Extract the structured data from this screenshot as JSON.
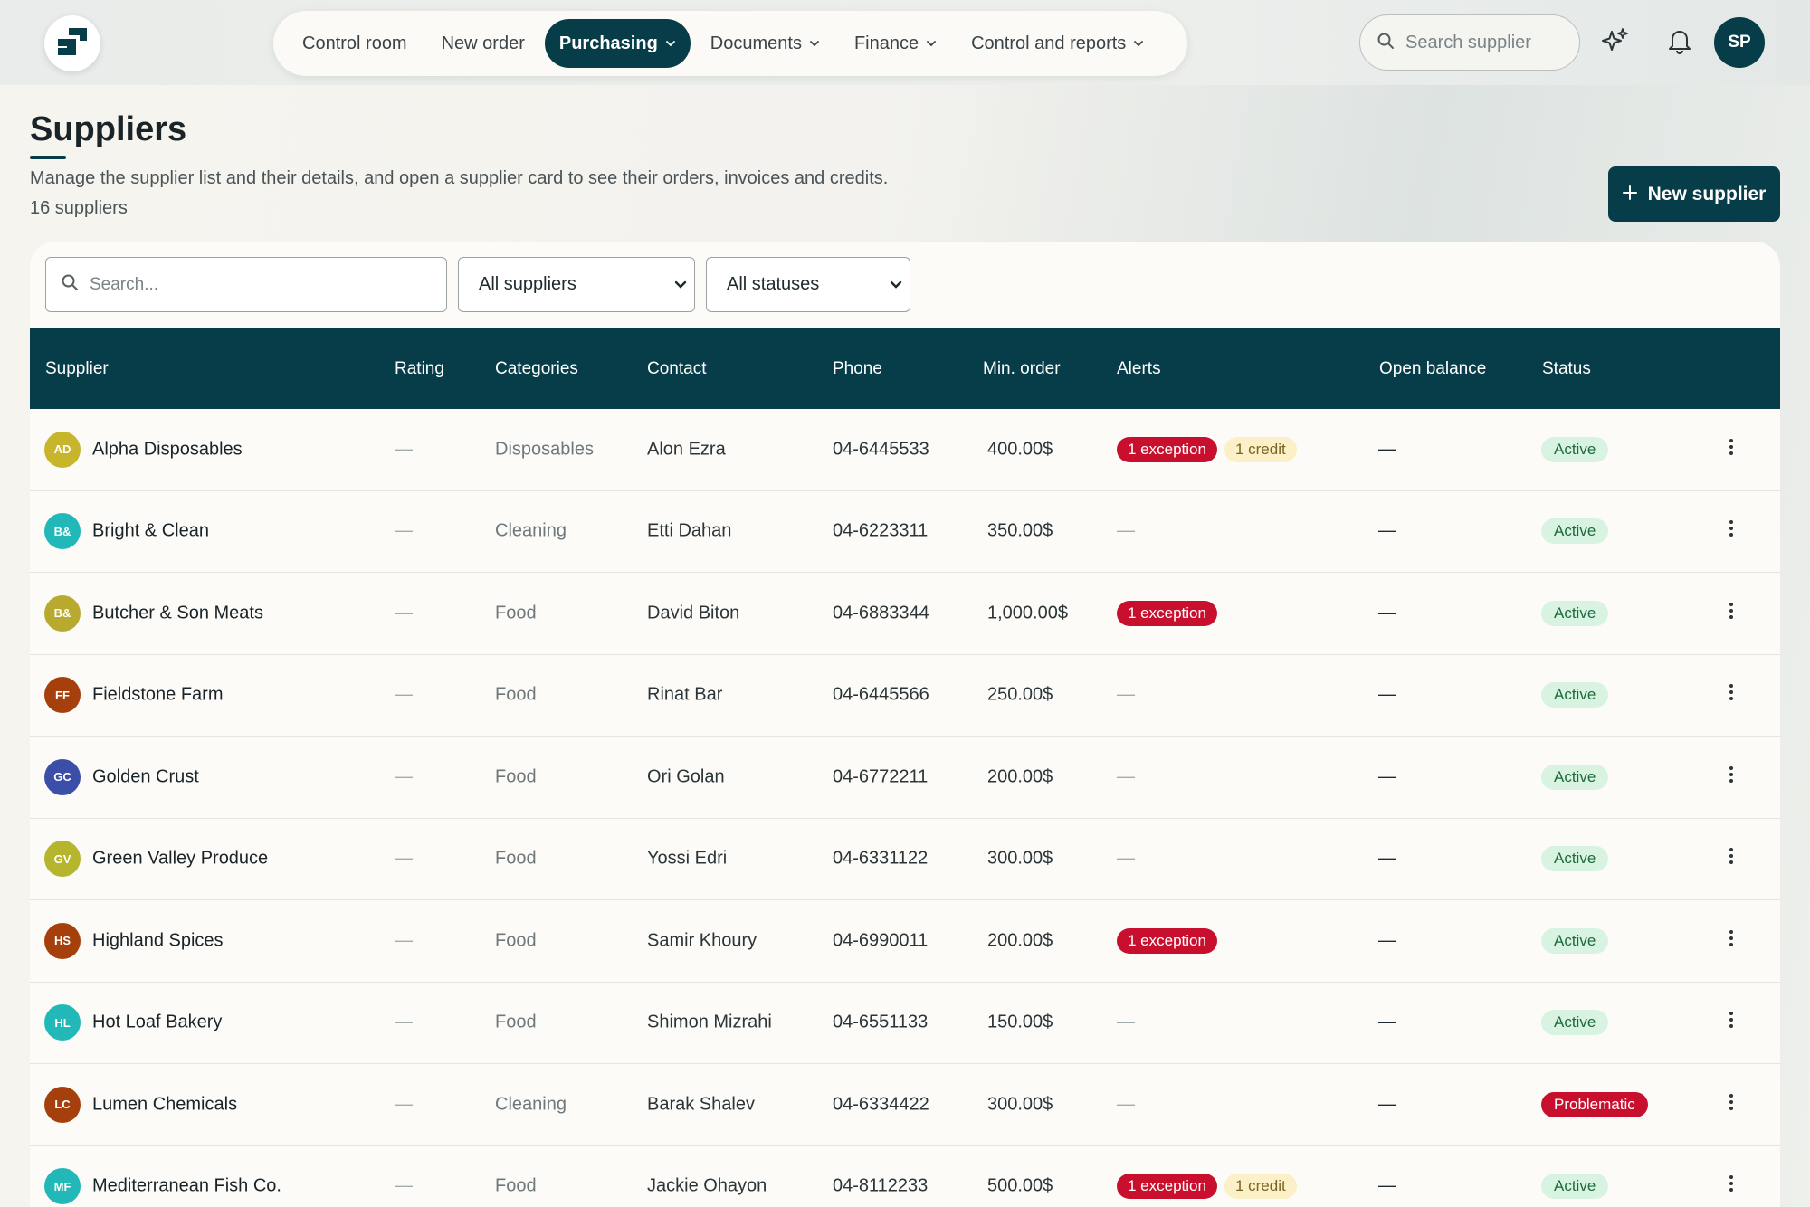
{
  "topbar": {
    "nav": [
      {
        "label": "Control room",
        "has_menu": false,
        "active": false
      },
      {
        "label": "New order",
        "has_menu": false,
        "active": false
      },
      {
        "label": "Purchasing",
        "has_menu": true,
        "active": true
      },
      {
        "label": "Documents",
        "has_menu": true,
        "active": false
      },
      {
        "label": "Finance",
        "has_menu": true,
        "active": false
      },
      {
        "label": "Control and reports",
        "has_menu": true,
        "active": false
      }
    ],
    "search_placeholder": "Search supplier",
    "user_initials": "SP",
    "icons": [
      "logo-icon",
      "sparkle-icon",
      "bell-icon",
      "search-icon"
    ]
  },
  "header": {
    "title": "Suppliers",
    "subtitle": "Manage the supplier list and their details, and open a supplier card to see their orders, invoices and credits.",
    "count": "16 suppliers",
    "new_button": "New supplier"
  },
  "filters": {
    "search_placeholder": "Search...",
    "supplier_filter": "All suppliers",
    "status_filter": "All statuses"
  },
  "table": {
    "columns": [
      "Supplier",
      "Rating",
      "Categories",
      "Contact",
      "Phone",
      "Min. order",
      "Alerts",
      "Open balance",
      "Status"
    ],
    "rows": [
      {
        "initials": "AD",
        "color": "#c7b52c",
        "name": "Alpha Disposables",
        "rating": "—",
        "category": "Disposables",
        "contact": "Alon Ezra",
        "phone": "04-6445533",
        "min_order": "400.00$",
        "alerts": [
          "1 exception",
          "1 credit"
        ],
        "balance": "—",
        "status": "Active"
      },
      {
        "initials": "B&",
        "color": "#22b8b8",
        "name": "Bright & Clean",
        "rating": "—",
        "category": "Cleaning",
        "contact": "Etti Dahan",
        "phone": "04-6223311",
        "min_order": "350.00$",
        "alerts": [],
        "balance": "—",
        "status": "Active"
      },
      {
        "initials": "B&",
        "color": "#b8aa2e",
        "name": "Butcher & Son Meats",
        "rating": "—",
        "category": "Food",
        "contact": "David Biton",
        "phone": "04-6883344",
        "min_order": "1,000.00$",
        "alerts": [
          "1 exception"
        ],
        "balance": "—",
        "status": "Active"
      },
      {
        "initials": "FF",
        "color": "#a5400c",
        "name": "Fieldstone Farm",
        "rating": "—",
        "category": "Food",
        "contact": "Rinat Bar",
        "phone": "04-6445566",
        "min_order": "250.00$",
        "alerts": [],
        "balance": "—",
        "status": "Active"
      },
      {
        "initials": "GC",
        "color": "#3b4ea8",
        "name": "Golden Crust",
        "rating": "—",
        "category": "Food",
        "contact": "Ori Golan",
        "phone": "04-6772211",
        "min_order": "200.00$",
        "alerts": [],
        "balance": "—",
        "status": "Active"
      },
      {
        "initials": "GV",
        "color": "#b5b52e",
        "name": "Green Valley Produce",
        "rating": "—",
        "category": "Food",
        "contact": "Yossi Edri",
        "phone": "04-6331122",
        "min_order": "300.00$",
        "alerts": [],
        "balance": "—",
        "status": "Active"
      },
      {
        "initials": "HS",
        "color": "#a5400c",
        "name": "Highland Spices",
        "rating": "—",
        "category": "Food",
        "contact": "Samir Khoury",
        "phone": "04-6990011",
        "min_order": "200.00$",
        "alerts": [
          "1 exception"
        ],
        "balance": "—",
        "status": "Active"
      },
      {
        "initials": "HL",
        "color": "#22b8b8",
        "name": "Hot Loaf Bakery",
        "rating": "—",
        "category": "Food",
        "contact": "Shimon Mizrahi",
        "phone": "04-6551133",
        "min_order": "150.00$",
        "alerts": [],
        "balance": "—",
        "status": "Active"
      },
      {
        "initials": "LC",
        "color": "#a5400c",
        "name": "Lumen Chemicals",
        "rating": "—",
        "category": "Cleaning",
        "contact": "Barak Shalev",
        "phone": "04-6334422",
        "min_order": "300.00$",
        "alerts": [],
        "balance": "—",
        "status": "Problematic"
      },
      {
        "initials": "MF",
        "color": "#22b8b8",
        "name": "Mediterranean Fish Co.",
        "rating": "—",
        "category": "Food",
        "contact": "Jackie Ohayon",
        "phone": "04-8112233",
        "min_order": "500.00$",
        "alerts": [
          "1 exception",
          "1 credit"
        ],
        "balance": "—",
        "status": "Active"
      }
    ]
  },
  "colors": {
    "brand": "#063d48",
    "exception": "#c8102e",
    "credit_bg": "#fbf0c8",
    "active_bg": "#d9f3e2",
    "problematic": "#c8102e"
  }
}
